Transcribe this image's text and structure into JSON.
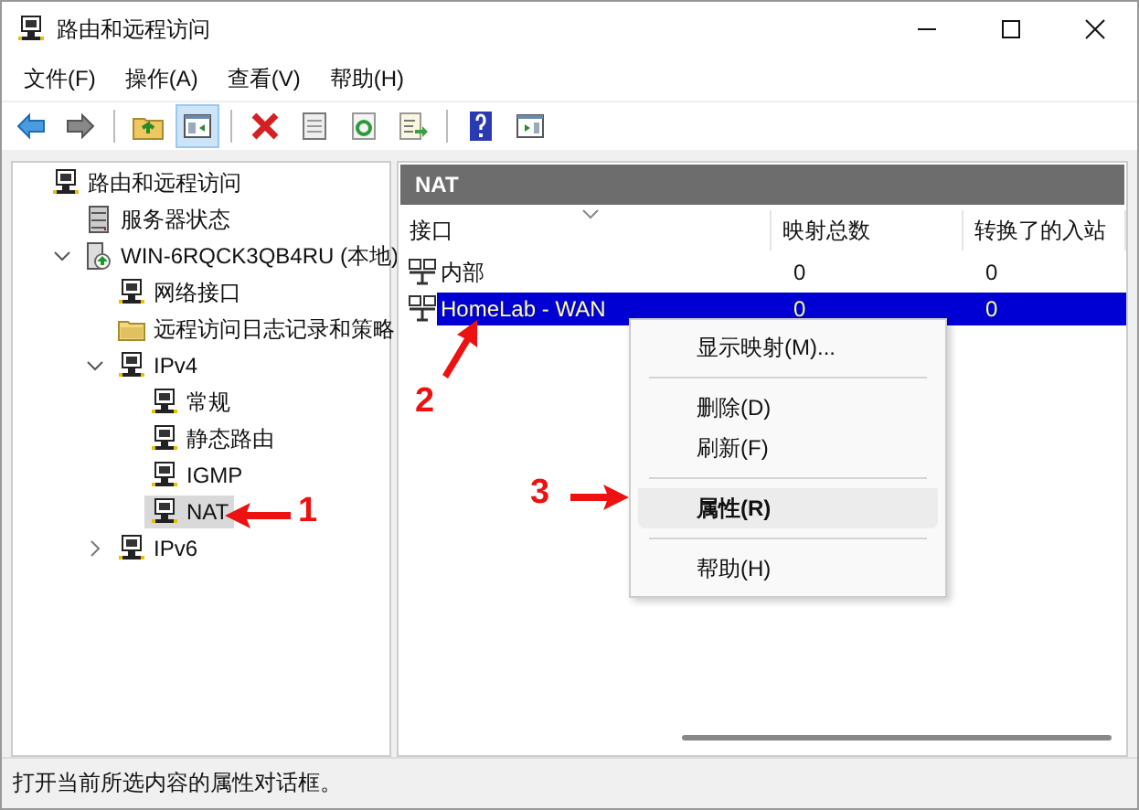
{
  "window": {
    "title": "路由和远程访问"
  },
  "menu": [
    "文件(F)",
    "操作(A)",
    "查看(V)",
    "帮助(H)"
  ],
  "toolbar": {
    "tree_toggle_pressed": true
  },
  "tree": [
    {
      "label": "路由和远程访问",
      "kind": "node",
      "selected": false,
      "children": [
        {
          "label": "服务器状态",
          "kind": "server",
          "selected": false
        },
        {
          "label": "WIN-6RQCK3QB4RU (本地)",
          "kind": "computer",
          "selected": false,
          "expanded": true,
          "children": [
            {
              "label": "网络接口",
              "kind": "node",
              "selected": false
            },
            {
              "label": "远程访问日志记录和策略",
              "kind": "folder",
              "selected": false
            },
            {
              "label": "IPv4",
              "kind": "node",
              "selected": false,
              "expanded": true,
              "children": [
                {
                  "label": "常规",
                  "kind": "node",
                  "selected": false
                },
                {
                  "label": "静态路由",
                  "kind": "node",
                  "selected": false
                },
                {
                  "label": "IGMP",
                  "kind": "node",
                  "selected": false
                },
                {
                  "label": "NAT",
                  "kind": "node",
                  "selected": true
                }
              ]
            },
            {
              "label": "IPv6",
              "kind": "node",
              "selected": false,
              "expanded": false
            }
          ]
        }
      ]
    }
  ],
  "pane_title": "NAT",
  "table": {
    "columns": [
      "接口",
      "映射总数",
      "转换了的入站"
    ],
    "rows": [
      {
        "cells": [
          "内部",
          "0",
          "0"
        ],
        "selected": false
      },
      {
        "cells": [
          "HomeLab - WAN",
          "0",
          "0"
        ],
        "selected": true
      }
    ]
  },
  "context_menu": [
    {
      "label": "显示映射(M)...",
      "separator_before": false,
      "default": false,
      "highlighted": false
    },
    {
      "label": "删除(D)",
      "separator_before": true,
      "default": false,
      "highlighted": false
    },
    {
      "label": "刷新(F)",
      "separator_before": false,
      "default": false,
      "highlighted": false
    },
    {
      "label": "属性(R)",
      "separator_before": true,
      "default": true,
      "highlighted": true
    },
    {
      "label": "帮助(H)",
      "separator_before": true,
      "default": false,
      "highlighted": false
    }
  ],
  "annotations": [
    {
      "label": "1"
    },
    {
      "label": "2"
    },
    {
      "label": "3"
    }
  ],
  "status_bar": "打开当前所选内容的属性对话框。"
}
